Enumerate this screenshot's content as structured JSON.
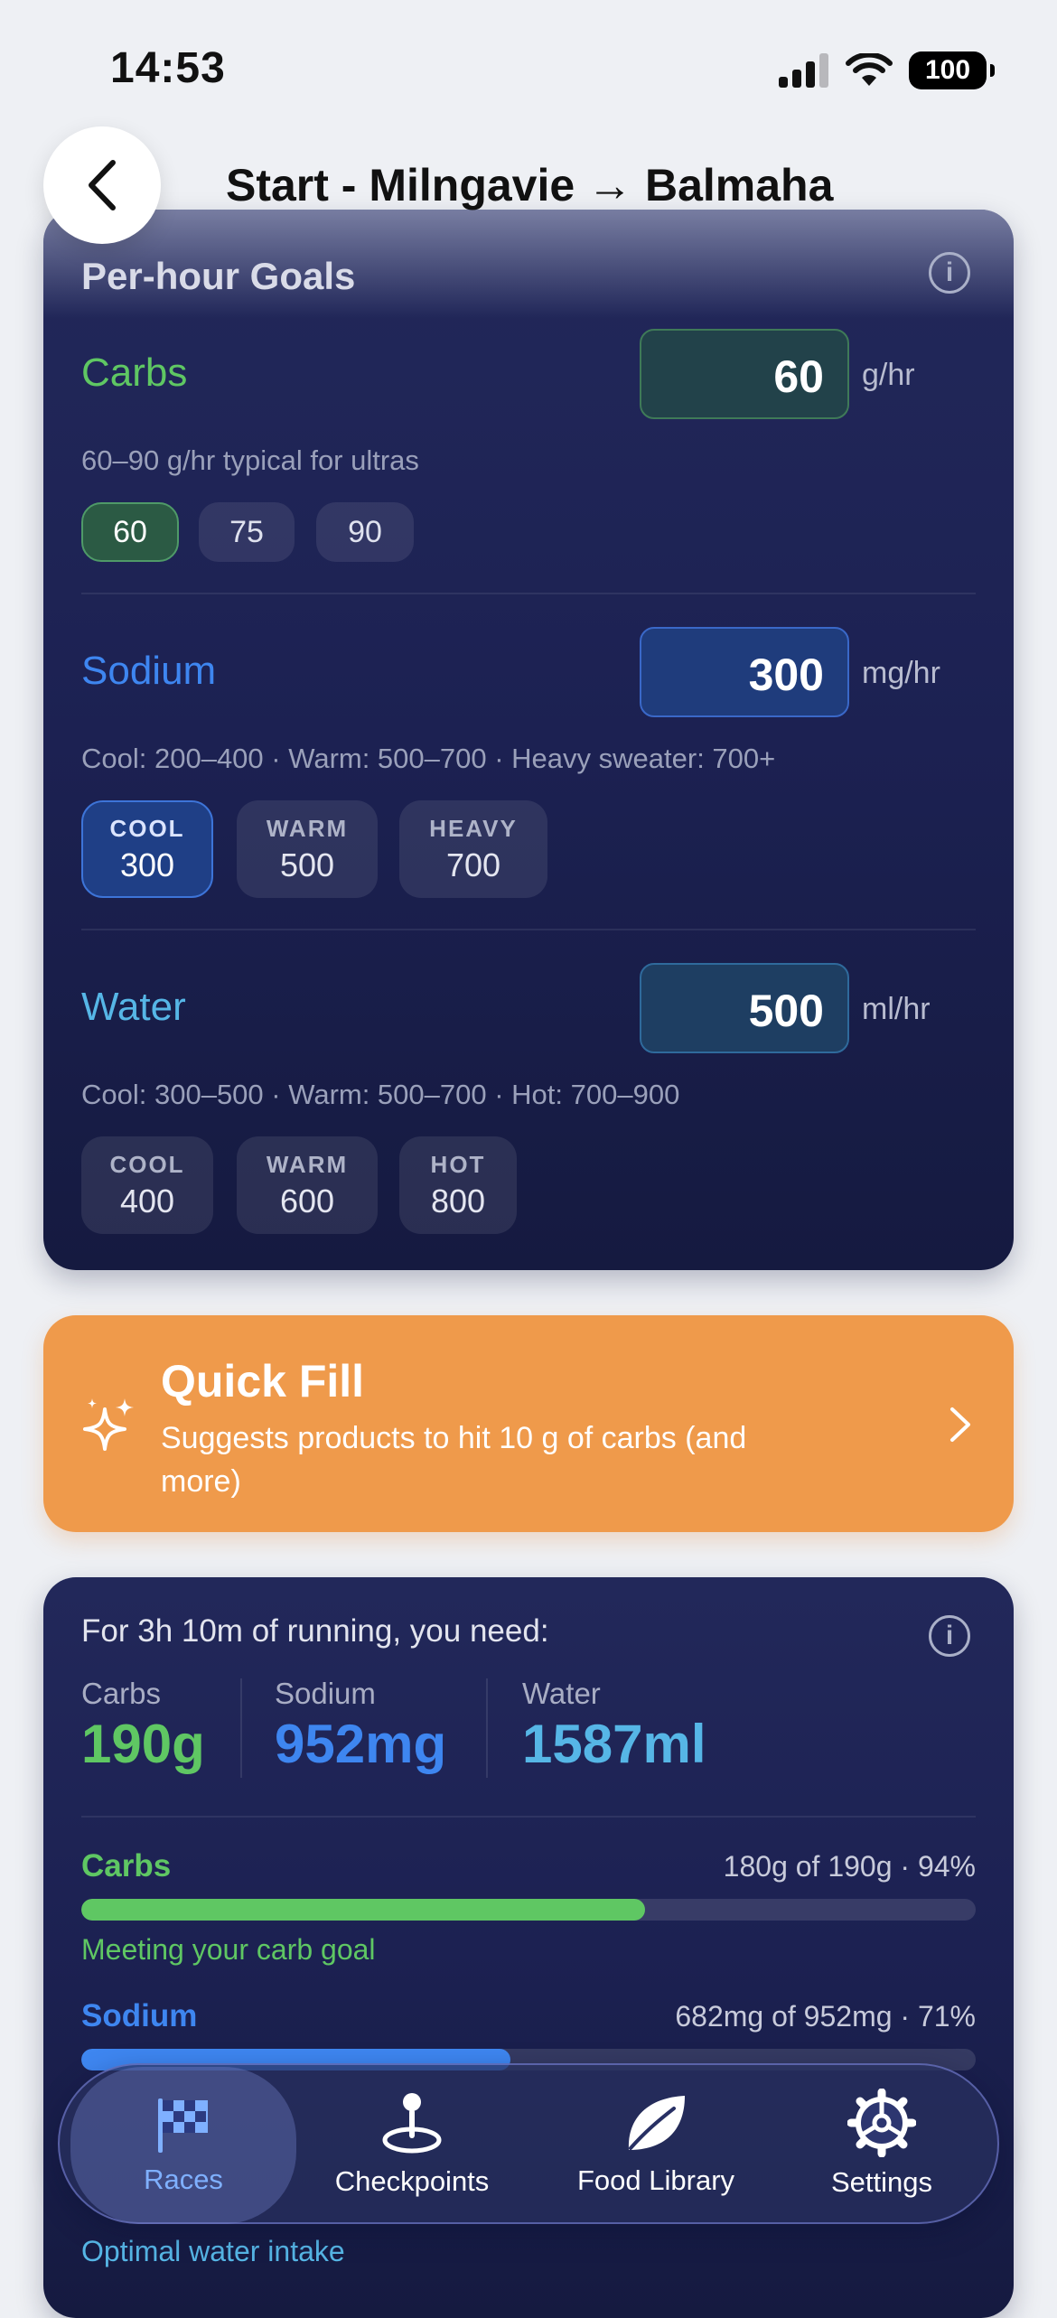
{
  "status_bar": {
    "time": "14:53",
    "battery": "100"
  },
  "nav": {
    "title": "Start - Milngavie → Balmaha"
  },
  "goals": {
    "title": "Per-hour Goals",
    "carbs": {
      "label": "Carbs",
      "value": "60",
      "unit": "g/hr",
      "hint": "60–90 g/hr typical for ultras",
      "presets": [
        "60",
        "75",
        "90"
      ]
    },
    "sodium": {
      "label": "Sodium",
      "value": "300",
      "unit": "mg/hr",
      "hint": "Cool: 200–400 · Warm: 500–700 · Heavy sweater: 700+",
      "presets": [
        {
          "title": "COOL",
          "value": "300"
        },
        {
          "title": "WARM",
          "value": "500"
        },
        {
          "title": "HEAVY",
          "value": "700"
        }
      ]
    },
    "water": {
      "label": "Water",
      "value": "500",
      "unit": "ml/hr",
      "hint": "Cool: 300–500 · Warm: 500–700 · Hot: 700–900",
      "presets": [
        {
          "title": "COOL",
          "value": "400"
        },
        {
          "title": "WARM",
          "value": "600"
        },
        {
          "title": "HOT",
          "value": "800"
        }
      ]
    }
  },
  "quick_fill": {
    "title": "Quick Fill",
    "subtitle": "Suggests products to hit 10 g of carbs (and more)"
  },
  "summary": {
    "heading": "For 3h 10m of running, you need:",
    "columns": [
      {
        "label": "Carbs",
        "value": "190g"
      },
      {
        "label": "Sodium",
        "value": "952mg"
      },
      {
        "label": "Water",
        "value": "1587ml"
      }
    ],
    "progress": [
      {
        "label": "Carbs",
        "stat": "180g of 190g · 94%",
        "fraction": 0.63,
        "message": "Meeting your carb goal"
      },
      {
        "label": "Sodium",
        "stat": "682mg of 952mg · 71%",
        "fraction": 0.48,
        "message": ""
      },
      {
        "label": "",
        "stat": "",
        "fraction": 0.0,
        "message": "Optimal water intake"
      }
    ]
  },
  "colors": {
    "carbs": "#5fc763",
    "sodium": "#3e86f0",
    "water": "#56b6e6",
    "quick_fill": "#ef9a4b",
    "card": "#1c2152"
  },
  "tabs": [
    {
      "label": "Races",
      "icon": "checkered-flag-icon",
      "active": true
    },
    {
      "label": "Checkpoints",
      "icon": "map-pin-icon",
      "active": false
    },
    {
      "label": "Food Library",
      "icon": "leaf-icon",
      "active": false
    },
    {
      "label": "Settings",
      "icon": "gear-icon",
      "active": false
    }
  ]
}
